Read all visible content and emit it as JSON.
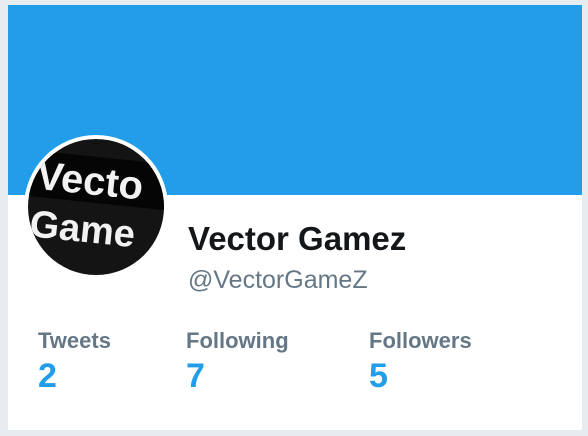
{
  "profile": {
    "name": "Vector Gamez",
    "handle": "@VectorGameZ",
    "avatar_text_line1": "Vecto",
    "avatar_text_line2": "Game"
  },
  "stats": {
    "tweets": {
      "label": "Tweets",
      "value": "2"
    },
    "following": {
      "label": "Following",
      "value": "7"
    },
    "followers": {
      "label": "Followers",
      "value": "5"
    }
  },
  "colors": {
    "banner": "#229de9",
    "stat_value": "#229de9",
    "muted_text": "#657786",
    "name_text": "#14171a",
    "page_background": "#e6ecf0"
  }
}
